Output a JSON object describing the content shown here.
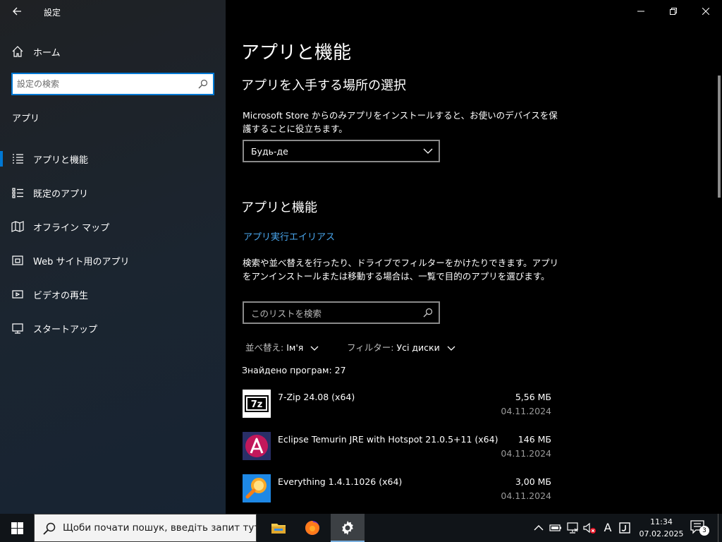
{
  "window": {
    "title": "設定",
    "back_icon": "arrow-left-icon",
    "minimize_icon": "minimize-icon",
    "maximize_icon": "restore-icon",
    "close_icon": "close-icon"
  },
  "sidebar": {
    "home_label": "ホーム",
    "search_placeholder": "設定の検索",
    "section_label": "アプリ",
    "items": [
      {
        "label": "アプリと機能",
        "icon": "list-icon",
        "active": true
      },
      {
        "label": "既定のアプリ",
        "icon": "default-apps-icon",
        "active": false
      },
      {
        "label": "オフライン マップ",
        "icon": "map-icon",
        "active": false
      },
      {
        "label": "Web サイト用のアプリ",
        "icon": "web-apps-icon",
        "active": false
      },
      {
        "label": "ビデオの再生",
        "icon": "video-icon",
        "active": false
      },
      {
        "label": "スタートアップ",
        "icon": "startup-icon",
        "active": false
      }
    ]
  },
  "main": {
    "title": "アプリと機能",
    "source_heading": "アプリを入手する場所の選択",
    "source_description": "Microsoft Store からのみアプリをインストールすると、お使いのデバイスを保護することに役立ちます。",
    "source_dropdown_value": "Будь-де",
    "apps_heading": "アプリと機能",
    "alias_link": "アプリ実行エイリアス",
    "apps_description": "検索や並べ替えを行ったり、ドライブでフィルターをかけたりできます。アプリをアンインストールまたは移動する場合は、一覧で目的のアプリを選びます。",
    "list_search_placeholder": "このリストを検索",
    "sort_label": "並べ替え:",
    "sort_value": "Ім'я",
    "filter_label": "フィルター:",
    "filter_value": "Усі диски",
    "found_count": "Знайдено програм: 27",
    "apps": [
      {
        "name": "7-Zip 24.08 (x64)",
        "size": "5,56 МБ",
        "date": "04.11.2024",
        "icon": "7zip-icon"
      },
      {
        "name": "Eclipse Temurin JRE with Hotspot 21.0.5+11 (x64)",
        "size": "146 МБ",
        "date": "04.11.2024",
        "icon": "temurin-icon"
      },
      {
        "name": "Everything 1.4.1.1026 (x64)",
        "size": "3,00 МБ",
        "date": "04.11.2024",
        "icon": "everything-icon"
      }
    ]
  },
  "taskbar": {
    "search_placeholder": "Щоби почати пошук, введіть запит тут",
    "pinned": [
      "file-explorer-icon",
      "firefox-icon",
      "settings-gear-icon"
    ],
    "ime_indicator": "A",
    "time": "11:34",
    "date": "07.02.2025",
    "notification_count": "3"
  },
  "colors": {
    "accent": "#0078d4",
    "link": "#4aa7ee",
    "content_bg": "#000000",
    "sidebar_bg": "#1b2530"
  }
}
